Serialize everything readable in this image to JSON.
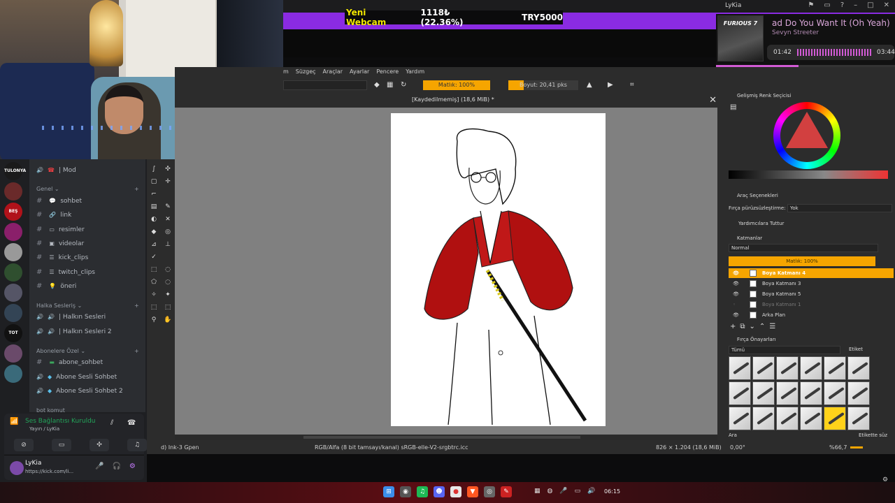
{
  "window": {
    "title": "LyKia"
  },
  "alert": {
    "label": "Yeni Webcam",
    "value": "1118₺ (22.36%)",
    "goal": "TRY5000"
  },
  "music": {
    "album_label": "FURIOUS 7",
    "song": "ad Do You Want It (Oh Yeah)",
    "artist": "Sevyn Streeter",
    "time_elapsed": "01:42",
    "time_total": "03:44",
    "progress_fraction": 0.46
  },
  "krita": {
    "menu": [
      "m",
      "Süzgeç",
      "Araçlar",
      "Ayarlar",
      "Pencere",
      "Yardım"
    ],
    "opacity_label": "Matlık: 100%",
    "size_label": "Boyut: 20,41 pks",
    "doc_title": "[Kaydedilmemiş]  (18,6 MiB) *",
    "status": {
      "brush": "d) Ink-3 Gpen",
      "color_space": "RGB/Alfa (8 bit tamsayı/kanal)  sRGB-elle-V2-srgbtrc.icc",
      "dims": "826 × 1.204 (18,6 MiB)",
      "rotation": "0,00°",
      "zoom": "%66,7"
    },
    "dockers": {
      "color_title": "Gelişmiş Renk Seçicisi",
      "tool_title": "Araç Seçenekleri",
      "smoothing_label": "Fırça pürüzsüzleştirme:",
      "smoothing_value": "Yok",
      "assist_label": "Yardımcılara Tuttur",
      "layers_title": "Katmanlar",
      "blend_mode": "Normal",
      "layer_opacity": "Matlık: 100%",
      "layers": [
        "Boya Katmanı 4",
        "Boya Katmanı 3",
        "Boya Katmanı 5",
        "Boya Katmanı 1",
        "Arka Plan"
      ],
      "presets_title": "Fırça Önayarları",
      "presets_filter": "Tümü",
      "tag_label": "Etiket",
      "search_label": "Ara",
      "tag_search_label": "Etikette süz"
    }
  },
  "discord": {
    "servers": [
      "TULONYA",
      "",
      "BEŞ",
      "",
      "",
      "",
      "",
      "",
      "TOT",
      "",
      ""
    ],
    "top_item": "| Mod",
    "categories": {
      "genel": "Genel",
      "halka": "Halka Sesleriş",
      "abone": "Abonelere Özel",
      "bot": "bot komut"
    },
    "text_channels": [
      "sohbet",
      "link",
      "resimler",
      "videolar",
      "kick_clips",
      "twitch_clips",
      "öneri"
    ],
    "public_voice": [
      "| Halkın Sesleri",
      "| Halkın Sesleri 2"
    ],
    "sub_channels": [
      "abone_sohbet",
      "Abone Sesli Sohbet",
      "Abone Sesli Sohbet 2"
    ],
    "voice_status": "Ses Bağlantısı Kuruldu",
    "voice_sub": "Yayın / LyKia",
    "user_name": "LyKia",
    "user_url": "https://kick.com/li..."
  },
  "taskbar": {
    "clock": "06:15"
  }
}
